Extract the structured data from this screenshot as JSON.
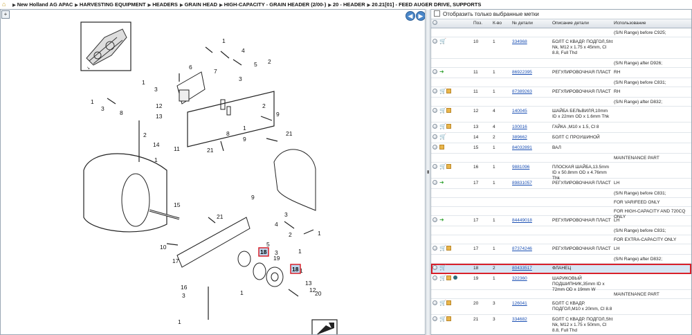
{
  "breadcrumbs": [
    "New Holland AG APAC",
    "HARVESTING EQUIPMENT",
    "HEADERS",
    "GRAIN HEAD",
    "HIGH-CAPACITY - GRAIN HEADER (2/00-)",
    "20 - HEADER",
    "20.21[01] - FEED AUGER DRIVE, SUPPORTS"
  ],
  "filter_label": "Отобразить только выбранные метки",
  "columns": {
    "pos": "Поз.",
    "qty": "К-во",
    "part": "№ детали",
    "desc": "Описание детали",
    "use": "Использование"
  },
  "diagram_labels": [
    "1",
    "2",
    "3",
    "4",
    "5",
    "6",
    "7",
    "8",
    "9",
    "10",
    "11",
    "12",
    "13",
    "14",
    "15",
    "16",
    "17",
    "18",
    "19",
    "20",
    "21"
  ],
  "rows": [
    {
      "type": "note",
      "use": "(S/N Range) before C925;"
    },
    {
      "type": "part",
      "icons": [
        "dot",
        "cart"
      ],
      "pos": "10",
      "qty": "1",
      "part": "334968",
      "desc": "БОЛТ С КВАДР. ПОДГОЛ,Sht Nk, M12 x 1.75 x 45mm, Cl 8.8, Full Thd",
      "use": ""
    },
    {
      "type": "note",
      "use": "(S/N Range) after D926;"
    },
    {
      "type": "part",
      "icons": [
        "dot",
        "gree"
      ],
      "pos": "11",
      "qty": "1",
      "part": "86922395",
      "desc": "РЕГУЛИРОВОЧНАЯ ПЛАСТ",
      "use": "RH"
    },
    {
      "type": "note",
      "use": "(S/N Range) before C831;"
    },
    {
      "type": "part",
      "icons": [
        "dot",
        "cart",
        "box"
      ],
      "pos": "11",
      "qty": "1",
      "part": "87389263",
      "desc": "РЕГУЛИРОВОЧНАЯ ПЛАСТ",
      "use": "RH"
    },
    {
      "type": "note",
      "use": "(S/N Range) after D832;"
    },
    {
      "type": "part",
      "icons": [
        "dot",
        "cart",
        "box"
      ],
      "pos": "12",
      "qty": "4",
      "part": "140045",
      "desc": "ШАЙБА БЕЛЬВИЛЯ,10mm ID x 22mm OD x 1.6mm Thk",
      "use": ""
    },
    {
      "type": "part",
      "icons": [
        "dot",
        "cart",
        "box"
      ],
      "pos": "13",
      "qty": "4",
      "part": "100016",
      "desc": "ГАЙКА ,M10 x 1.5, Cl 8",
      "use": ""
    },
    {
      "type": "part",
      "icons": [
        "dot",
        "cart"
      ],
      "pos": "14",
      "qty": "2",
      "part": "389662",
      "desc": "БОЛТ С ПРОУШИНОЙ",
      "use": ""
    },
    {
      "type": "part",
      "icons": [
        "dot",
        "box"
      ],
      "pos": "15",
      "qty": "1",
      "part": "84032891",
      "desc": "ВАЛ",
      "use": ""
    },
    {
      "type": "note",
      "use": "MAINTENANCE PART"
    },
    {
      "type": "part",
      "icons": [
        "dot",
        "cart",
        "box"
      ],
      "pos": "16",
      "qty": "1",
      "part": "9881096",
      "desc": "ПЛОСКАЯ ШАЙБА,13.5mm ID x 50.8mm OD x 4.76mm Thk",
      "use": ""
    },
    {
      "type": "part",
      "icons": [
        "dot",
        "gree"
      ],
      "pos": "17",
      "qty": "1",
      "part": "89831057",
      "desc": "РЕГУЛИРОВОЧНАЯ ПЛАСТ",
      "use": "LH"
    },
    {
      "type": "note",
      "use": "(S/N Range) before C831;"
    },
    {
      "type": "note",
      "use": "FOR VARIFEED ONLY"
    },
    {
      "type": "note",
      "use": "FOR HIGH-CAPACITY AND 720CQ ONLY"
    },
    {
      "type": "part",
      "icons": [
        "dot",
        "gree"
      ],
      "pos": "17",
      "qty": "1",
      "part": "84449018",
      "desc": "РЕГУЛИРОВОЧНАЯ ПЛАСТ",
      "use": "LH"
    },
    {
      "type": "note",
      "use": "(S/N Range) before C831;"
    },
    {
      "type": "note",
      "use": "FOR EXTRA-CAPACITY ONLY"
    },
    {
      "type": "part",
      "icons": [
        "dot",
        "cart",
        "box"
      ],
      "pos": "17",
      "qty": "1",
      "part": "87374246",
      "desc": "РЕГУЛИРОВОЧНАЯ ПЛАСТ",
      "use": "LH"
    },
    {
      "type": "note",
      "use": "(S/N Range) after D832;"
    },
    {
      "type": "part",
      "sel": true,
      "icons": [
        "dot",
        "cart"
      ],
      "pos": "18",
      "qty": "2",
      "part": "80433517",
      "desc": "ФЛАНЕЦ",
      "use": ""
    },
    {
      "type": "part",
      "icons": [
        "dot",
        "cart",
        "box",
        "globe"
      ],
      "pos": "19",
      "qty": "1",
      "part": "322360",
      "desc": "ШАРИКОВЫЙ ПОДШИПНИК,35mm ID x 72mm OD x 19mm W",
      "use": ""
    },
    {
      "type": "note",
      "use": "MAINTENANCE PART"
    },
    {
      "type": "part",
      "icons": [
        "dot",
        "cart",
        "box"
      ],
      "pos": "20",
      "qty": "3",
      "part": "126041",
      "desc": "БОЛТ С КВАДР. ПОДГОЛ,M10 x 20mm, Cl 8.8",
      "use": ""
    },
    {
      "type": "part",
      "icons": [
        "dot",
        "cart",
        "box"
      ],
      "pos": "21",
      "qty": "3",
      "part": "334682",
      "desc": "БОЛТ С КВАДР. ПОДГОЛ,Sht Nk, M12 x 1.75 x 50mm, Cl 8.8, Full Thd",
      "use": ""
    }
  ]
}
